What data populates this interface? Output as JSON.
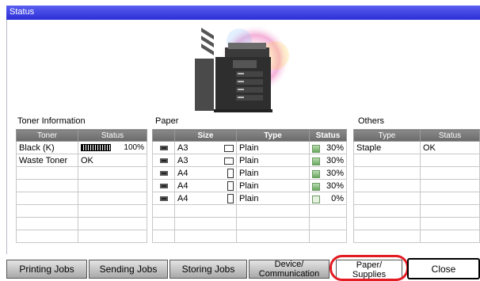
{
  "window": {
    "title": "Status"
  },
  "toner": {
    "title": "Toner Information",
    "columns": [
      "Toner",
      "Status"
    ],
    "rows": [
      {
        "name": "Black (K)",
        "level": 1.0,
        "status": "100%"
      },
      {
        "name": "Waste Toner",
        "status": "OK"
      }
    ]
  },
  "paper": {
    "title": "Paper",
    "columns": [
      "Size",
      "Type",
      "Status"
    ],
    "rows": [
      {
        "size": "A3",
        "orientation": "landscape",
        "type": "Plain",
        "status": "30%",
        "level": 0.3
      },
      {
        "size": "A3",
        "orientation": "landscape",
        "type": "Plain",
        "status": "30%",
        "level": 0.3
      },
      {
        "size": "A4",
        "orientation": "portrait",
        "type": "Plain",
        "status": "30%",
        "level": 0.3
      },
      {
        "size": "A4",
        "orientation": "portrait",
        "type": "Plain",
        "status": "30%",
        "level": 0.3
      },
      {
        "size": "A4",
        "orientation": "portrait",
        "type": "Plain",
        "status": "0%",
        "level": 0
      }
    ]
  },
  "others": {
    "title": "Others",
    "columns": [
      "Type",
      "Status"
    ],
    "rows": [
      {
        "type": "Staple",
        "status": "OK"
      }
    ]
  },
  "tabs": [
    {
      "label": "Printing Jobs"
    },
    {
      "label": "Sending Jobs"
    },
    {
      "label": "Storing Jobs"
    },
    {
      "label_line1": "Device/",
      "label_line2": "Communication"
    },
    {
      "label_line1": "Paper/",
      "label_line2": "Supplies",
      "active": true
    }
  ],
  "close_label": "Close",
  "colors": {
    "title_bar": "#3d40e3",
    "highlight": "#e31b23"
  }
}
